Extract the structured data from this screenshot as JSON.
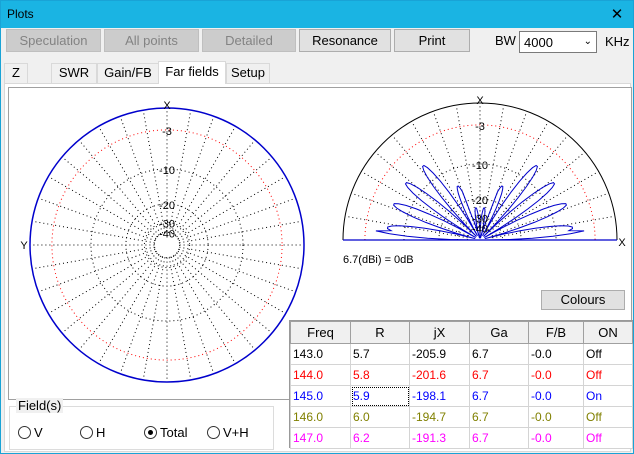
{
  "window": {
    "title": "Plots",
    "close_glyph": "✕"
  },
  "toolbar": {
    "buttons": [
      {
        "label": "Speculation",
        "enabled": false
      },
      {
        "label": "All points",
        "enabled": false
      },
      {
        "label": "Detailed",
        "enabled": false
      },
      {
        "label": "Resonance",
        "enabled": true
      },
      {
        "label": "Print",
        "enabled": true
      }
    ],
    "bw_label": "BW",
    "bw_value": "4000",
    "bw_unit": "KHz"
  },
  "tabs": [
    {
      "label": "Z",
      "active": false
    },
    {
      "label": "SWR",
      "active": false
    },
    {
      "label": "Gain/FB",
      "active": false
    },
    {
      "label": "Far fields",
      "active": true
    },
    {
      "label": "Setup",
      "active": false
    }
  ],
  "plots": {
    "azimuth": {
      "top_label": "X",
      "left_label": "Y",
      "ring_labels": [
        "-3",
        "-10",
        "-20",
        "-30",
        "-40"
      ]
    },
    "elevation": {
      "top_label": "X",
      "right_label": "X",
      "ring_labels": [
        "-3",
        "-10",
        "-20",
        "-30",
        "-40"
      ],
      "reference": "6.7(dBi) = 0dB"
    },
    "colors": {
      "pattern": "#0000cc",
      "ref_ring": "#ff0000",
      "grid": "#000000"
    }
  },
  "colours_button": "Colours",
  "fields": {
    "legend": "Field(s)",
    "options": [
      {
        "label": "V",
        "selected": false
      },
      {
        "label": "H",
        "selected": false
      },
      {
        "label": "Total",
        "selected": true
      },
      {
        "label": "V+H",
        "selected": false
      }
    ]
  },
  "table": {
    "headers": [
      "Freq",
      "R",
      "jX",
      "Ga",
      "F/B",
      "ON"
    ],
    "rows": [
      {
        "cells": [
          "143.0",
          "5.7",
          "-205.9",
          "6.7",
          "-0.0",
          "Off"
        ],
        "color": "#000000"
      },
      {
        "cells": [
          "144.0",
          "5.8",
          "-201.6",
          "6.7",
          "-0.0",
          "Off"
        ],
        "color": "#ff0000"
      },
      {
        "cells": [
          "145.0",
          "5.9",
          "-198.1",
          "6.7",
          "-0.0",
          "On"
        ],
        "color": "#0000ff"
      },
      {
        "cells": [
          "146.0",
          "6.0",
          "-194.7",
          "6.7",
          "-0.0",
          "Off"
        ],
        "color": "#808000"
      },
      {
        "cells": [
          "147.0",
          "6.2",
          "-191.3",
          "6.7",
          "-0.0",
          "Off"
        ],
        "color": "#ff00ff"
      }
    ]
  }
}
